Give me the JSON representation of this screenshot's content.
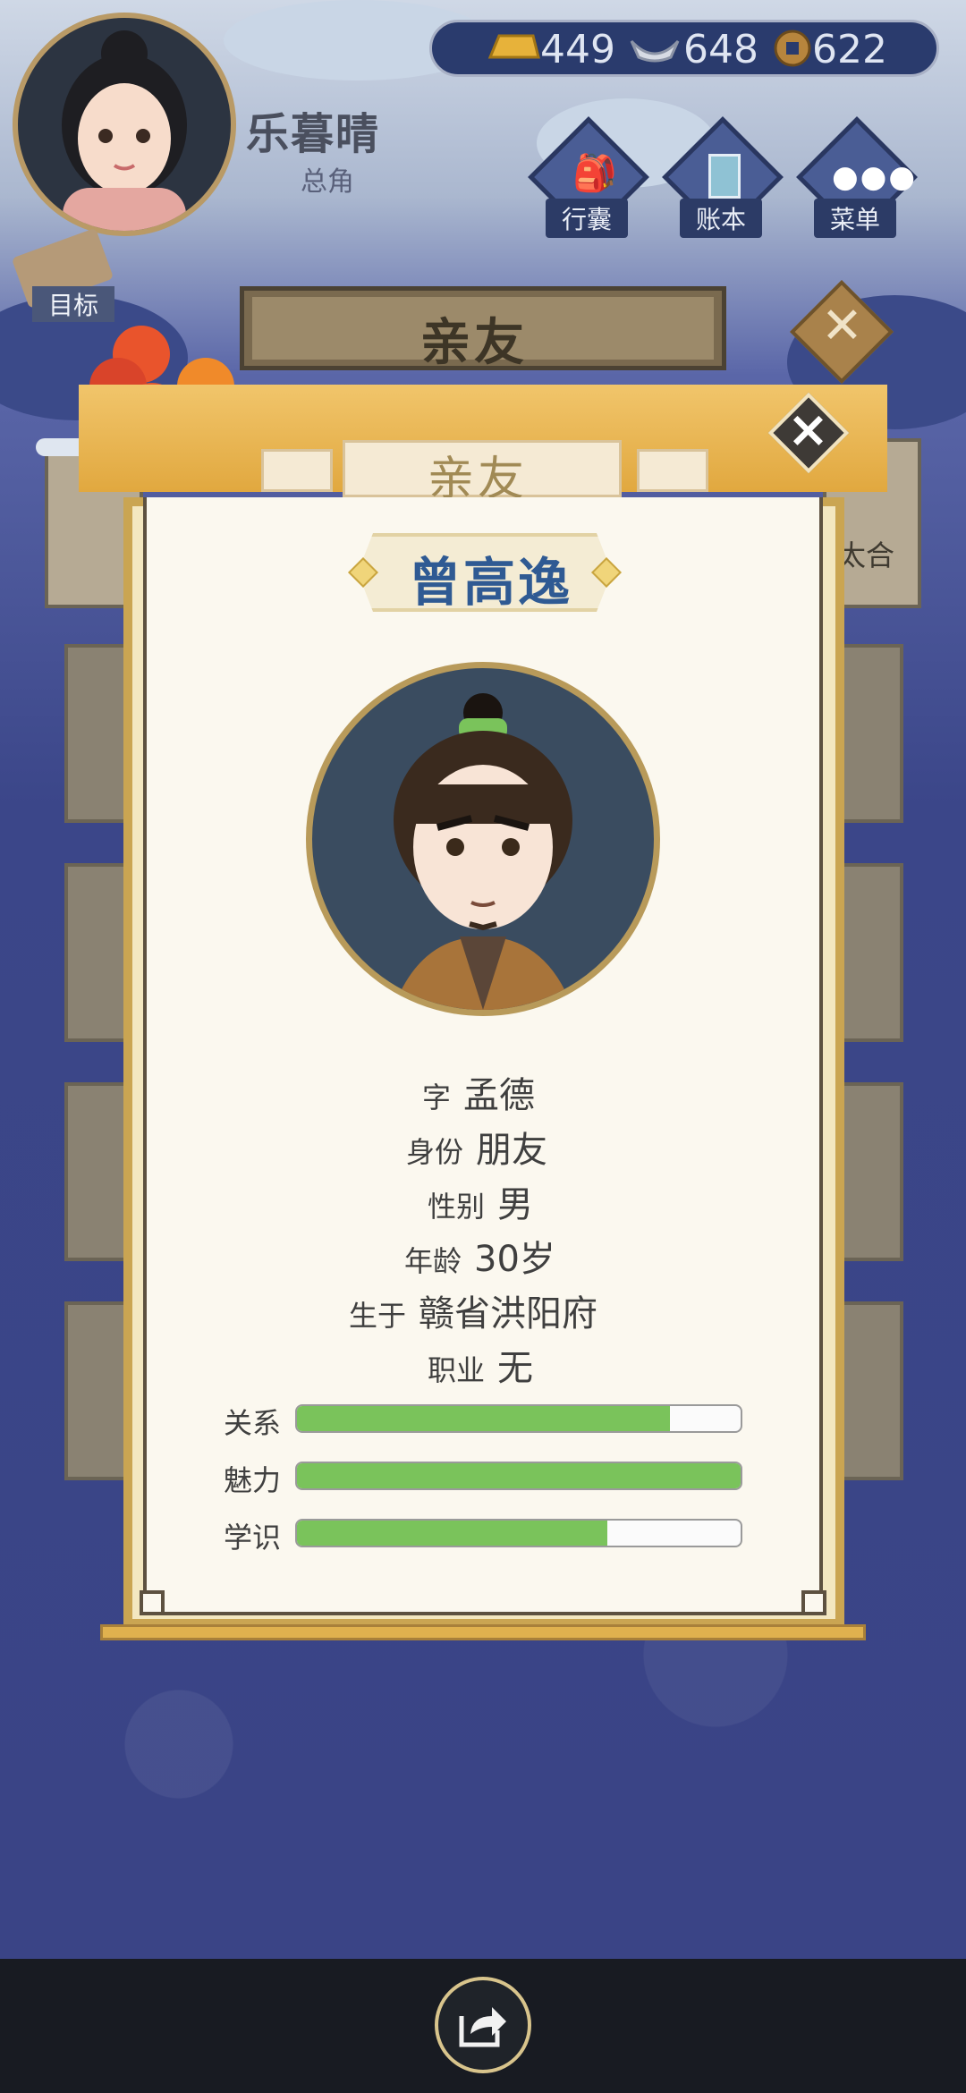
{
  "player": {
    "name": "乐暮晴",
    "role": "总角"
  },
  "currency": {
    "gold": "449",
    "silver": "648",
    "copper": "622"
  },
  "menu": {
    "bag": "行囊",
    "ledger": "账本",
    "menu": "菜单"
  },
  "goal": {
    "label": "目标"
  },
  "section": {
    "title": "亲友",
    "side_text": "太合"
  },
  "modal": {
    "header": "亲友",
    "character_name": "曾高逸",
    "info": [
      {
        "label": "字",
        "value": "孟德"
      },
      {
        "label": "身份",
        "value": "朋友"
      },
      {
        "label": "性别",
        "value": "男"
      },
      {
        "label": "年龄",
        "value": "30岁"
      },
      {
        "label": "生于",
        "value": "赣省洪阳府"
      },
      {
        "label": "职业",
        "value": "无"
      }
    ],
    "bars": [
      {
        "label": "关系",
        "percent": 84
      },
      {
        "label": "魅力",
        "percent": 100
      },
      {
        "label": "学识",
        "percent": 70
      }
    ]
  },
  "colors": {
    "accent_gold": "#e1a83f",
    "bar_green": "#7ac35b",
    "name_blue": "#2f5a93"
  },
  "icons": [
    "gold-bar-icon",
    "silver-ingot-icon",
    "copper-coin-icon",
    "bag-icon",
    "ledger-icon",
    "menu-dots-icon",
    "close-icon",
    "share-icon"
  ]
}
